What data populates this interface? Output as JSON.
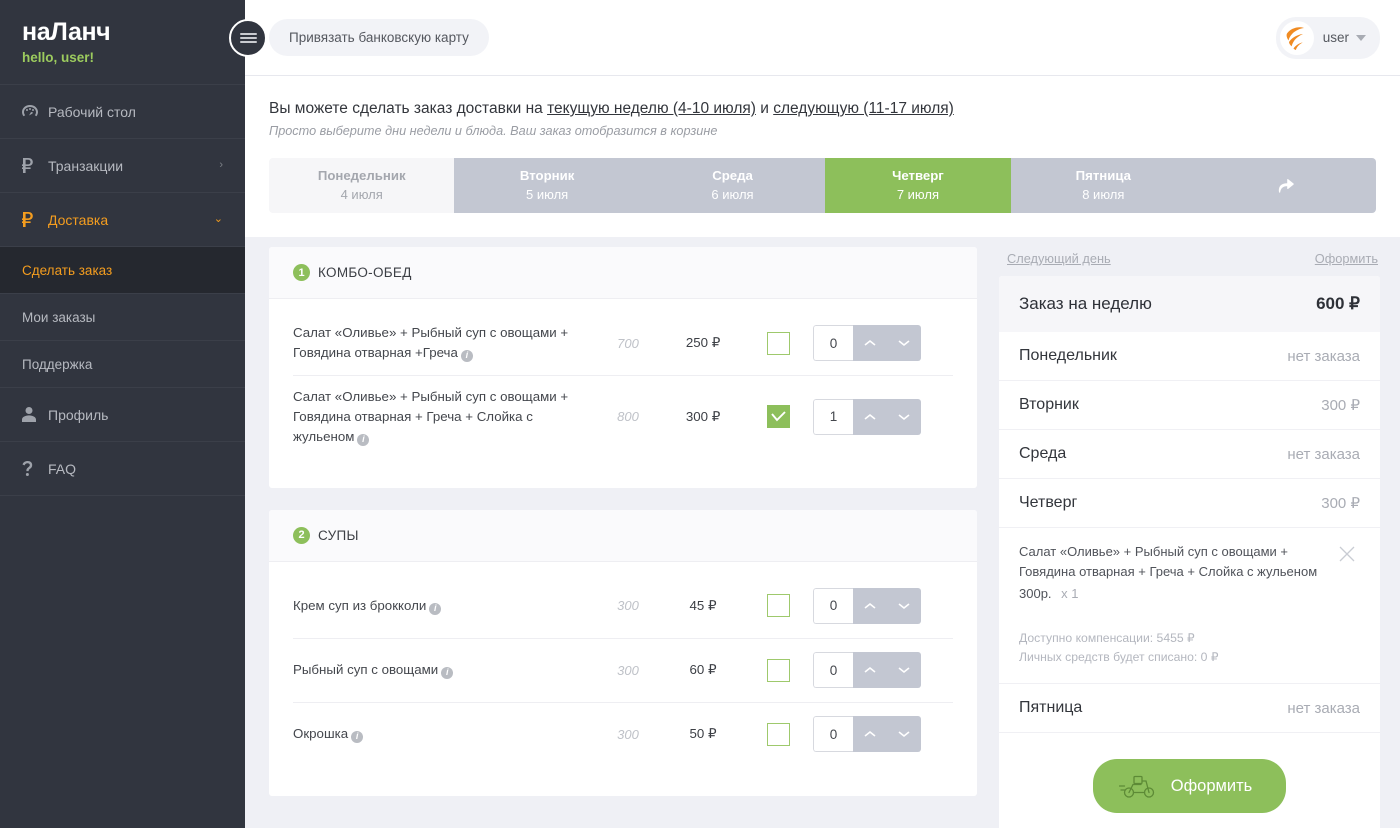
{
  "brand": {
    "title": "наЛанч",
    "greeting": "hello, user!",
    "menu_icon": "hamburger-icon"
  },
  "sidebar": {
    "items": [
      {
        "label": "Рабочий стол",
        "icon": "dashboard-icon",
        "caret": "",
        "state": "normal"
      },
      {
        "label": "Транзакции",
        "icon": "ruble-icon",
        "caret": "›",
        "state": "normal"
      },
      {
        "label": "Доставка",
        "icon": "ruble-icon",
        "caret": "⌄",
        "state": "active-parent"
      }
    ],
    "sub_items": [
      {
        "label": "Сделать заказ",
        "state": "active"
      },
      {
        "label": "Мои заказы",
        "state": "normal"
      },
      {
        "label": "Поддержка",
        "state": "normal"
      }
    ],
    "items_bottom": [
      {
        "label": "Профиль",
        "icon": "user-icon",
        "caret": "",
        "state": "normal"
      },
      {
        "label": "FAQ",
        "icon": "question-icon",
        "caret": "",
        "state": "normal"
      }
    ]
  },
  "topbar": {
    "link_card_label": "Привязать банковскую карту",
    "user_name": "user",
    "avatar_icon": "swoosh-logo-icon",
    "caret_icon": "chevron-down-icon"
  },
  "intro": {
    "text_before": "Вы можете сделать заказ доставки на ",
    "link_current": "текущую неделю (4-10 июля)",
    "text_middle": " и ",
    "link_next": "следующую (11-17 июля)",
    "subtitle": "Просто выберите дни недели и блюда. Ваш заказ отобразится в корзине"
  },
  "day_tabs": {
    "next_arrow_icon": "arrow-forward-icon",
    "items": [
      {
        "name": "Понедельник",
        "date": "4 июля",
        "state": "past"
      },
      {
        "name": "Вторник",
        "date": "5 июля",
        "state": "idle"
      },
      {
        "name": "Среда",
        "date": "6 июля",
        "state": "idle"
      },
      {
        "name": "Четверг",
        "date": "7 июля",
        "state": "active"
      },
      {
        "name": "Пятница",
        "date": "8 июля",
        "state": "idle"
      }
    ]
  },
  "menu_sections": [
    {
      "number": "1",
      "title": "КОМБО-ОБЕД",
      "dishes": [
        {
          "name": "Салат «Оливье» + Рыбный суп с овощами + Говядина отварная +Греча",
          "info_icon": "info-icon",
          "weight": "700",
          "price": "250 ₽",
          "checked": false,
          "qty": "0",
          "up_icon": "chevron-up-icon",
          "down_icon": "chevron-down-icon"
        },
        {
          "name": "Салат «Оливье» + Рыбный суп с овощами + Говядина отварная + Греча + Слойка с жульеном",
          "info_icon": "info-icon",
          "weight": "800",
          "price": "300 ₽",
          "checked": true,
          "qty": "1",
          "up_icon": "chevron-up-icon",
          "down_icon": "chevron-down-icon"
        }
      ]
    },
    {
      "number": "2",
      "title": "СУПЫ",
      "dishes": [
        {
          "name": "Крем суп из брокколи",
          "info_icon": "info-icon",
          "weight": "300",
          "price": "45 ₽",
          "checked": false,
          "qty": "0",
          "up_icon": "chevron-up-icon",
          "down_icon": "chevron-down-icon"
        },
        {
          "name": "Рыбный суп с овощами",
          "info_icon": "info-icon",
          "weight": "300",
          "price": "60 ₽",
          "checked": false,
          "qty": "0",
          "up_icon": "chevron-up-icon",
          "down_icon": "chevron-down-icon"
        },
        {
          "name": "Окрошка",
          "info_icon": "info-icon",
          "weight": "300",
          "price": "50 ₽",
          "checked": false,
          "qty": "0",
          "up_icon": "chevron-up-icon",
          "down_icon": "chevron-down-icon"
        }
      ]
    }
  ],
  "cart": {
    "link_next_day": "Следующий день",
    "link_checkout_top": "Оформить",
    "total_label": "Заказ на неделю",
    "total_value": "600 ₽",
    "days": [
      {
        "label": "Понедельник",
        "value": "нет заказа"
      },
      {
        "label": "Вторник",
        "value": "300 ₽"
      },
      {
        "label": "Среда",
        "value": "нет заказа"
      },
      {
        "label": "Четверг",
        "value": "300 ₽"
      }
    ],
    "item": {
      "name": "Салат «Оливье» + Рыбный суп с овощами + Говядина отварная + Греча + Слойка с жульеном",
      "price": "300р.",
      "qty": "х 1",
      "remove_icon": "close-icon"
    },
    "notes": [
      "Доступно компенсации: 5455 ₽",
      "Личных средств будет списано: 0 ₽"
    ],
    "day_after": {
      "label": "Пятница",
      "value": "нет заказа"
    },
    "cta_label": "Оформить",
    "cta_icon": "scooter-delivery-icon"
  },
  "colors": {
    "sidebar_bg": "#31353f",
    "sidebar_sub_active_bg": "#25282f",
    "accent_orange": "#f49d1f",
    "accent_green": "#8dbf5b",
    "greeting_green": "#9ccb5e",
    "tab_idle": "#c3c7d2",
    "page_bg": "#eff0f5"
  }
}
